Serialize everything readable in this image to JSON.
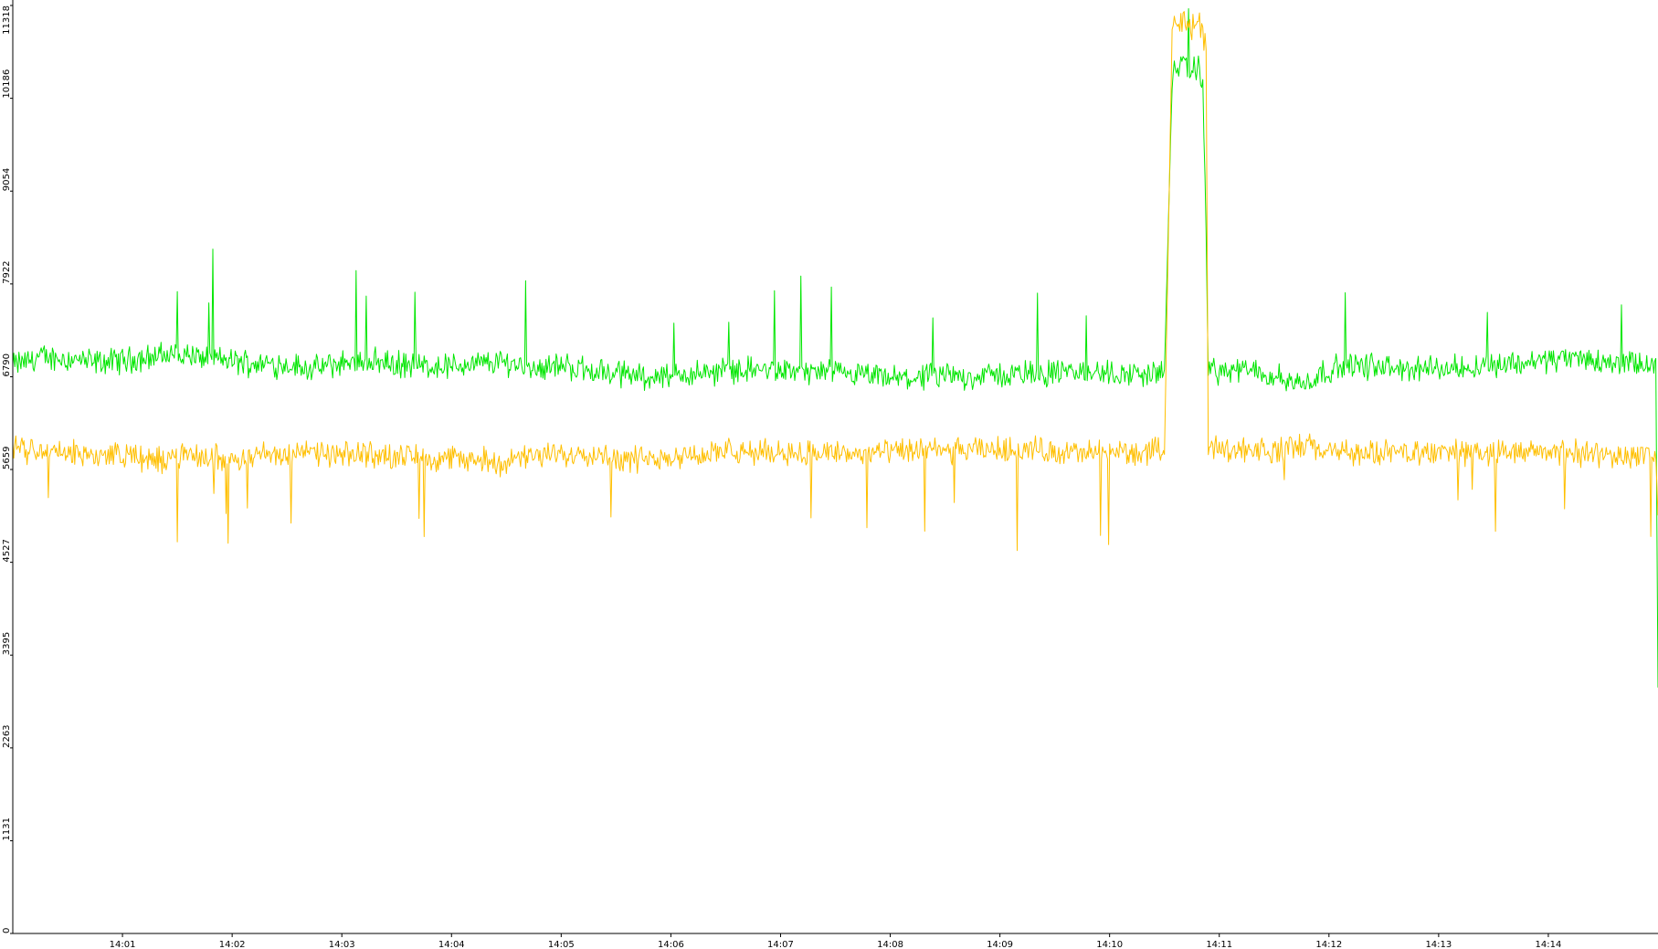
{
  "chart_data": {
    "type": "line",
    "title": "",
    "xlabel": "",
    "ylabel": "",
    "ylim": [
      0,
      11318
    ],
    "xlim_minutes": [
      0,
      15
    ],
    "grid": false,
    "legend": "none",
    "background": "#ffffff",
    "axis_color": "#000000",
    "y_ticks": [
      {
        "value": 0,
        "label": "0"
      },
      {
        "value": 1131,
        "label": "1131"
      },
      {
        "value": 2263,
        "label": "2263"
      },
      {
        "value": 3395,
        "label": "3395"
      },
      {
        "value": 4527,
        "label": "4527"
      },
      {
        "value": 5659,
        "label": "5659"
      },
      {
        "value": 6790,
        "label": "6790"
      },
      {
        "value": 7922,
        "label": "7922"
      },
      {
        "value": 9054,
        "label": "9054"
      },
      {
        "value": 10186,
        "label": "10186"
      },
      {
        "value": 11318,
        "label": "11318"
      }
    ],
    "x_ticks": [
      {
        "value": 1,
        "label": "14:01"
      },
      {
        "value": 2,
        "label": "14:02"
      },
      {
        "value": 3,
        "label": "14:03"
      },
      {
        "value": 4,
        "label": "14:04"
      },
      {
        "value": 5,
        "label": "14:05"
      },
      {
        "value": 6,
        "label": "14:06"
      },
      {
        "value": 7,
        "label": "14:07"
      },
      {
        "value": 8,
        "label": "14:08"
      },
      {
        "value": 9,
        "label": "14:09"
      },
      {
        "value": 10,
        "label": "14:10"
      },
      {
        "value": 11,
        "label": "14:11"
      },
      {
        "value": 12,
        "label": "14:12"
      },
      {
        "value": 13,
        "label": "14:13"
      },
      {
        "value": 14,
        "label": "14:14"
      }
    ],
    "series": [
      {
        "color": "#00e600",
        "x": [
          0.0,
          0.25,
          0.5,
          0.75,
          1.0,
          1.25,
          1.5,
          1.75,
          2.0,
          2.25,
          2.5,
          2.75,
          3.0,
          3.25,
          3.5,
          3.75,
          4.0,
          4.25,
          4.5,
          4.75,
          5.0,
          5.25,
          5.5,
          5.75,
          6.0,
          6.25,
          6.5,
          6.75,
          7.0,
          7.25,
          7.5,
          7.75,
          8.0,
          8.25,
          8.5,
          8.75,
          9.0,
          9.25,
          9.5,
          9.75,
          10.0,
          10.25,
          10.5,
          10.57,
          10.6,
          10.65,
          10.7,
          10.75,
          10.8,
          10.85,
          10.88,
          10.9,
          10.95,
          11.0,
          11.25,
          11.5,
          11.75,
          12.0,
          12.25,
          12.5,
          12.75,
          13.0,
          13.25,
          13.5,
          13.75,
          14.0,
          14.25,
          14.5,
          14.75,
          14.98,
          15.0
        ],
        "y": [
          6930,
          7030,
          7010,
          6960,
          6990,
          7030,
          7070,
          7020,
          6980,
          6950,
          6940,
          6880,
          6960,
          6990,
          6940,
          6920,
          6920,
          6950,
          6970,
          6900,
          6930,
          6870,
          6830,
          6800,
          6790,
          6830,
          6870,
          6880,
          6860,
          6850,
          6820,
          6800,
          6760,
          6780,
          6790,
          6800,
          6810,
          6830,
          6840,
          6850,
          6830,
          6820,
          6850,
          10400,
          10550,
          10600,
          10520,
          10500,
          10550,
          10450,
          8500,
          6900,
          6870,
          6850,
          6870,
          6800,
          6700,
          6880,
          6930,
          6900,
          6880,
          6890,
          6920,
          6940,
          6960,
          7000,
          7020,
          6970,
          6940,
          6940,
          3000
        ]
      },
      {
        "color": "#ffbf00",
        "x": [
          0.0,
          0.25,
          0.5,
          0.75,
          1.0,
          1.25,
          1.5,
          1.75,
          2.0,
          2.25,
          2.5,
          2.75,
          3.0,
          3.25,
          3.5,
          3.75,
          4.0,
          4.25,
          4.5,
          4.75,
          5.0,
          5.25,
          5.5,
          5.75,
          6.0,
          6.25,
          6.5,
          6.75,
          7.0,
          7.25,
          7.5,
          7.75,
          8.0,
          8.25,
          8.5,
          8.75,
          9.0,
          9.25,
          9.5,
          9.75,
          10.0,
          10.25,
          10.5,
          10.57,
          10.6,
          10.65,
          10.7,
          10.75,
          10.8,
          10.85,
          10.88,
          10.9,
          10.95,
          11.0,
          11.25,
          11.5,
          11.75,
          12.0,
          12.25,
          12.5,
          12.75,
          13.0,
          13.25,
          13.5,
          13.75,
          14.0,
          14.25,
          14.5,
          14.75,
          14.98,
          15.0
        ],
        "y": [
          5900,
          5880,
          5860,
          5830,
          5850,
          5760,
          5820,
          5810,
          5800,
          5840,
          5850,
          5860,
          5820,
          5860,
          5820,
          5810,
          5790,
          5770,
          5750,
          5810,
          5850,
          5870,
          5800,
          5780,
          5830,
          5840,
          5870,
          5860,
          5880,
          5870,
          5860,
          5850,
          5870,
          5890,
          5880,
          5890,
          5900,
          5910,
          5880,
          5850,
          5870,
          5860,
          5880,
          11000,
          11150,
          11200,
          11100,
          11050,
          11150,
          11000,
          10800,
          5900,
          5920,
          5920,
          5910,
          5880,
          5950,
          5880,
          5860,
          5850,
          5860,
          5870,
          5880,
          5850,
          5860,
          5880,
          5860,
          5830,
          5840,
          5830,
          5100
        ]
      }
    ]
  }
}
